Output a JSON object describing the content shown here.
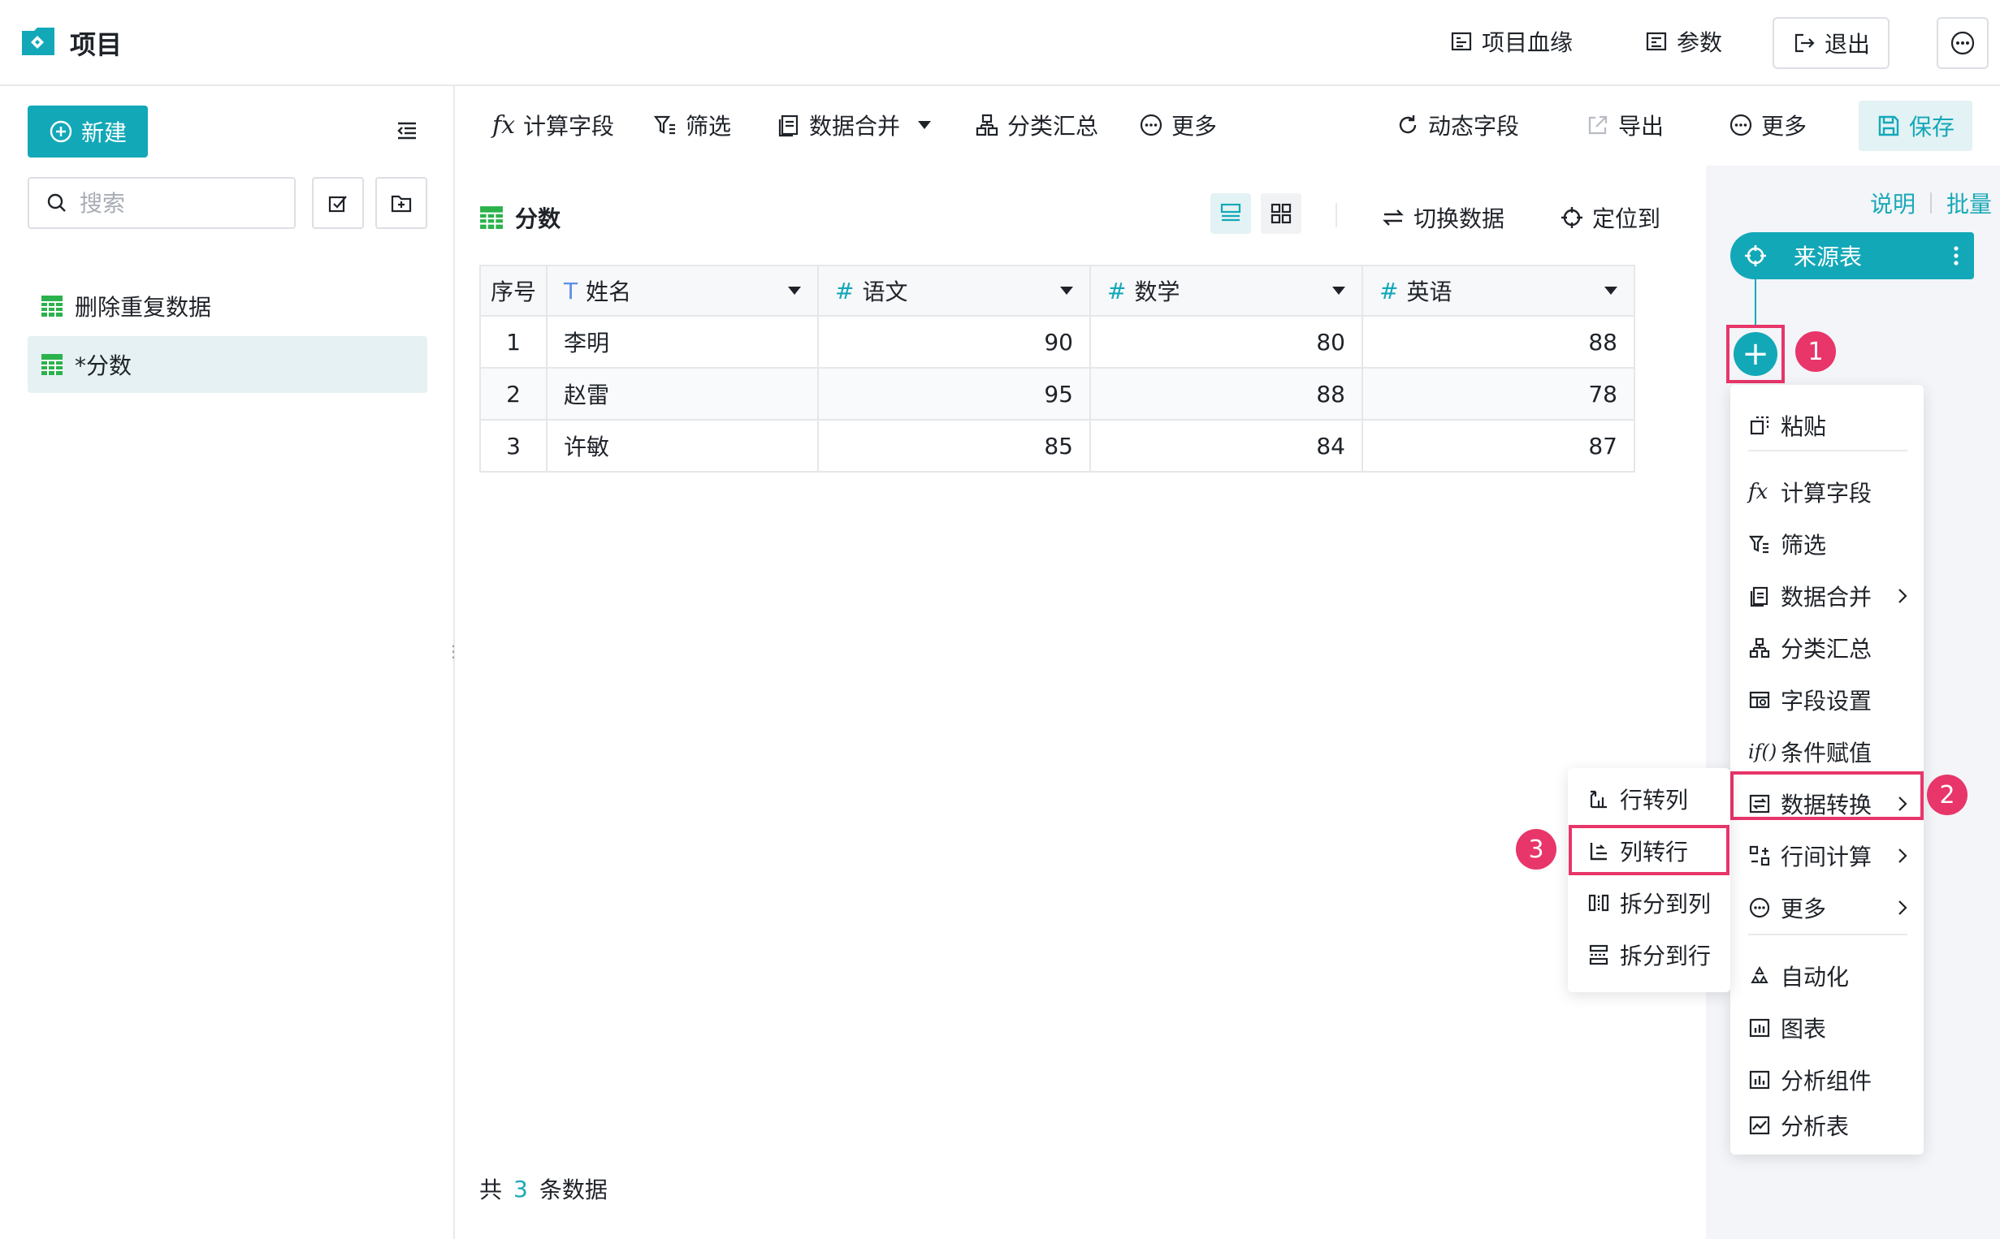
{
  "app": {
    "title": "项目"
  },
  "header": {
    "lineage": "项目血缘",
    "params": "参数",
    "logout": "退出"
  },
  "sidebar": {
    "new_label": "新建",
    "search_placeholder": "搜索",
    "items": [
      {
        "label": "删除重复数据"
      },
      {
        "label": "*分数"
      }
    ]
  },
  "toolbar": {
    "calc_field": "计算字段",
    "filter": "筛选",
    "merge": "数据合并",
    "group_summary": "分类汇总",
    "more": "更多",
    "dynamic_field": "动态字段",
    "export": "导出",
    "more2": "更多",
    "save": "保存"
  },
  "table": {
    "title": "分数",
    "switch_data": "切换数据",
    "locate": "定位到",
    "columns": [
      {
        "label": "序号",
        "type": ""
      },
      {
        "label": "姓名",
        "type": "T"
      },
      {
        "label": "语文",
        "type": "#"
      },
      {
        "label": "数学",
        "type": "#"
      },
      {
        "label": "英语",
        "type": "#"
      }
    ],
    "rows": [
      [
        "1",
        "李明",
        "90",
        "80",
        "88"
      ],
      [
        "2",
        "赵雷",
        "95",
        "88",
        "78"
      ],
      [
        "3",
        "许敏",
        "85",
        "84",
        "87"
      ]
    ],
    "footer_prefix": "共",
    "footer_count": "3",
    "footer_suffix": "条数据"
  },
  "flow": {
    "explain": "说明",
    "batch": "批量",
    "source_node": "来源表",
    "badges": [
      "1",
      "2",
      "3"
    ]
  },
  "context_menu": {
    "items": [
      {
        "label": "粘贴",
        "icon": "paste-icon"
      },
      {
        "label": "计算字段",
        "icon": "fx-icon"
      },
      {
        "label": "筛选",
        "icon": "filter-icon"
      },
      {
        "label": "数据合并",
        "icon": "merge-icon",
        "submenu": true
      },
      {
        "label": "分类汇总",
        "icon": "group-icon"
      },
      {
        "label": "字段设置",
        "icon": "field-settings-icon"
      },
      {
        "label": "条件赋值",
        "icon": "if-icon"
      },
      {
        "label": "数据转换",
        "icon": "transform-icon",
        "submenu": true
      },
      {
        "label": "行间计算",
        "icon": "row-calc-icon",
        "submenu": true
      },
      {
        "label": "更多",
        "icon": "more-icon",
        "submenu": true
      },
      {
        "label": "自动化",
        "icon": "automation-icon"
      },
      {
        "label": "图表",
        "icon": "chart-icon"
      },
      {
        "label": "分析组件",
        "icon": "analysis-component-icon"
      },
      {
        "label": "分析表",
        "icon": "analysis-table-icon"
      }
    ]
  },
  "submenu": {
    "items": [
      {
        "label": "行转列",
        "icon": "row-to-col-icon"
      },
      {
        "label": "列转行",
        "icon": "col-to-row-icon"
      },
      {
        "label": "拆分到列",
        "icon": "split-col-icon"
      },
      {
        "label": "拆分到行",
        "icon": "split-row-icon"
      }
    ]
  },
  "colors": {
    "accent": "#13a8b8",
    "highlight": "#e8356a",
    "sheet_green": "#2bb24c"
  }
}
